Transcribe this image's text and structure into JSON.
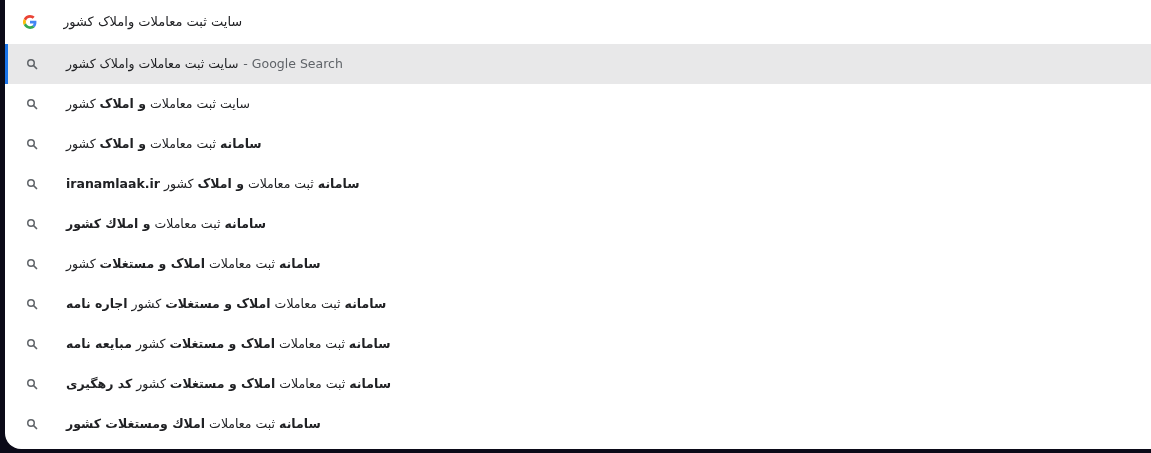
{
  "omnibox": {
    "value": "سایت ثبت معاملات واملاک کشور"
  },
  "suggestions": [
    {
      "text": "سایت ثبت معاملات واملاک کشور",
      "suffix": "- Google Search",
      "selected": true
    },
    {
      "text": "سایت ثبت معاملات **و املاک** کشور",
      "selected": false
    },
    {
      "text": "**سامانه** ثبت معاملات **و املاک** کشور",
      "selected": false
    },
    {
      "text": "**سامانه** ثبت معاملات **و املاک** کشور **iranamlaak.ir**",
      "selected": false
    },
    {
      "text": "**سامانه** ثبت معاملات **و املاك كشور**",
      "selected": false
    },
    {
      "text": "**سامانه** ثبت معاملات **املاک و مستغلات** کشور",
      "selected": false
    },
    {
      "text": "**سامانه** ثبت معاملات **املاک و مستغلات** کشور **اجاره نامه**",
      "selected": false
    },
    {
      "text": "**سامانه** ثبت معاملات **املاک و مستغلات** کشور **مبایعه نامه**",
      "selected": false
    },
    {
      "text": "**سامانه** ثبت معاملات **املاک و مستغلات** کشور **کد رهگیری**",
      "selected": false
    },
    {
      "text": "**سامانه** ثبت معاملات **املاك ومستغلات كشور**",
      "selected": false
    }
  ]
}
